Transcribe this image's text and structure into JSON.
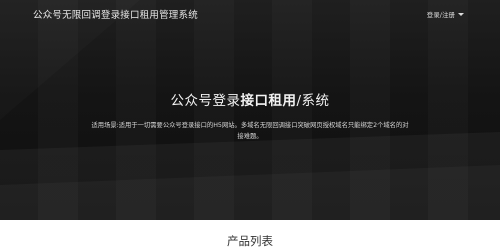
{
  "navbar": {
    "brand": "公众号无限回调登录接口租用管理系统",
    "login_label": "登录/注册"
  },
  "hero": {
    "title_part1": "公众号登录",
    "title_part2": "接口租用",
    "title_part3": "/系统",
    "description": "适用场景:适用于一切需要公众号登录接口的H5网站。多域名无限回调接口突破网页授权域名只能绑定2个域名的对接难题。"
  },
  "products": {
    "title": "产品列表"
  },
  "colors": {
    "hero_bg": "#151515",
    "hero_text": "#f2f2f2",
    "page_bg": "#ffffff"
  }
}
